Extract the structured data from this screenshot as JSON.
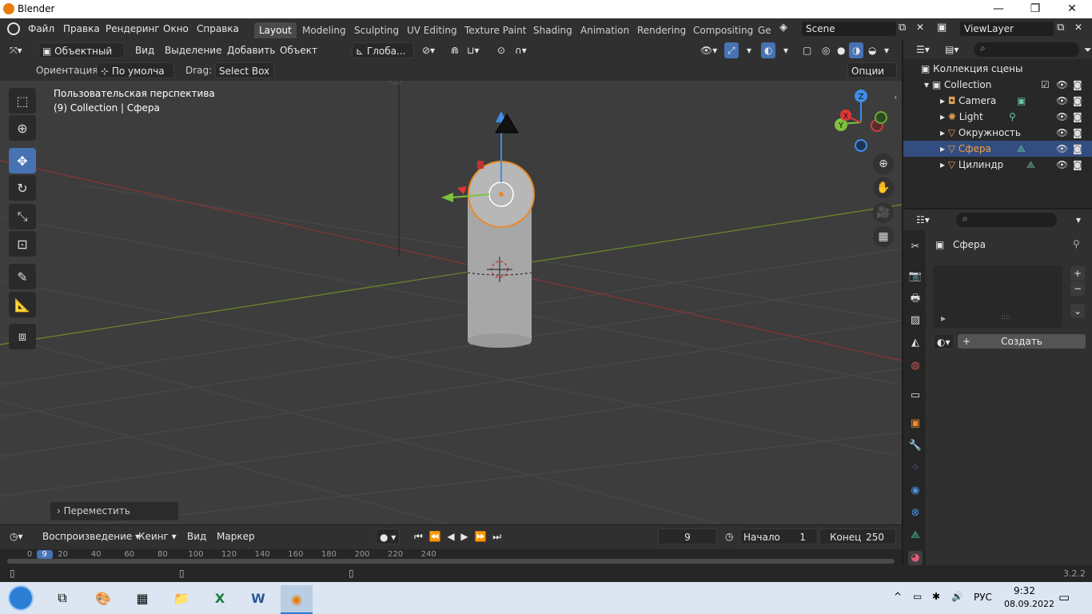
{
  "window": {
    "title": "Blender"
  },
  "menu": [
    "Файл",
    "Правка",
    "Рендеринг",
    "Окно",
    "Справка"
  ],
  "workspaces": [
    "Layout",
    "Modeling",
    "Sculpting",
    "UV Editing",
    "Texture Paint",
    "Shading",
    "Animation",
    "Rendering",
    "Compositing",
    "Ge"
  ],
  "scene": "Scene",
  "view_layer": "ViewLayer",
  "viewport_header": {
    "mode": "Объектный ...",
    "menus": [
      "Вид",
      "Выделение",
      "Добавить",
      "Объект"
    ],
    "transform_orientation": "Глоба...",
    "orientation_label": "Ориентация:",
    "orientation_value": "По умолча",
    "drag_label": "Drag:",
    "drag_value": "Select Box",
    "options": "Опции"
  },
  "viewport": {
    "perspective_label": "Пользовательская перспектива",
    "collection_label": "(9) Collection | Сфера",
    "last_op": "Переместить",
    "gizmo": {
      "x": "X",
      "y": "Y",
      "z": "Z"
    }
  },
  "timeline": {
    "playback": "Воспроизведение",
    "keying": "Кеинг",
    "view": "Вид",
    "marker": "Маркер",
    "current_frame": "9",
    "start_label": "Начало",
    "start": "1",
    "end_label": "Конец",
    "end": "250",
    "ticks": [
      "0",
      "20",
      "40",
      "60",
      "80",
      "100",
      "120",
      "140",
      "160",
      "180",
      "200",
      "220",
      "240"
    ]
  },
  "outliner": {
    "root": "Коллекция сцены",
    "collection": "Collection",
    "items": [
      {
        "name": "Camera",
        "icon": "camera-icon"
      },
      {
        "name": "Light",
        "icon": "light-icon"
      },
      {
        "name": "Окружность",
        "icon": "mesh-icon"
      },
      {
        "name": "Сфера",
        "icon": "mesh-icon",
        "selected": true
      },
      {
        "name": "Цилиндр",
        "icon": "mesh-icon"
      }
    ]
  },
  "properties": {
    "object_name": "Сфера",
    "create_button": "Создать"
  },
  "status": {
    "version": "3.2.2"
  },
  "taskbar": {
    "lang": "РУС",
    "time": "9:32",
    "date": "08.09.2022"
  },
  "colors": {
    "accent": "#4772b3",
    "selection": "#e88a2b",
    "bg": "#3d3d3d"
  }
}
